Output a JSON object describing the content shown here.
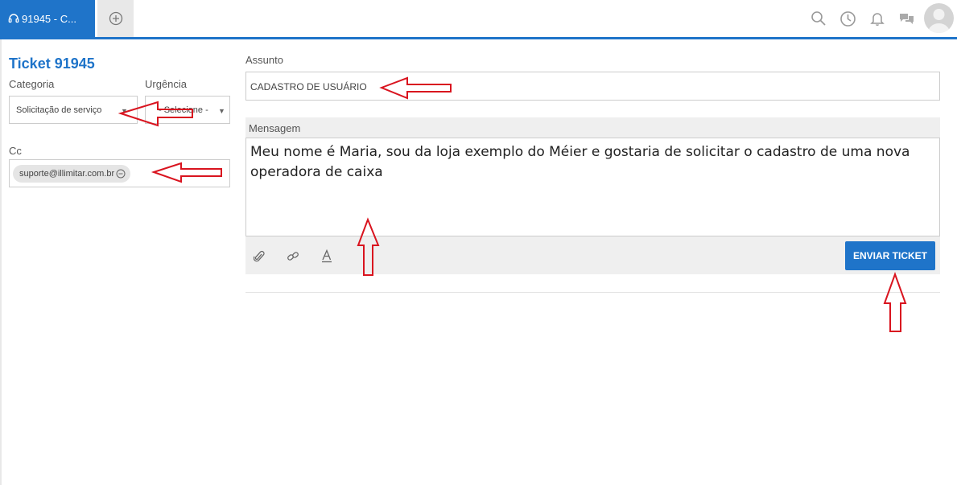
{
  "tabs": [
    {
      "label": "91945 - C..."
    }
  ],
  "header_icons": [
    "search-icon",
    "history-icon",
    "bell-icon",
    "chat-icon"
  ],
  "colors": {
    "accent": "#1f74c9",
    "annotation_arrow": "#d9141f"
  },
  "ticket": {
    "title": "Ticket 91945",
    "categoria_label": "Categoria",
    "categoria_value": "Solicitação de serviço",
    "urgencia_label": "Urgência",
    "urgencia_value": "- Selecione -",
    "cc_label": "Cc",
    "cc_value": "suporte@illimitar.com.br"
  },
  "subject": {
    "label": "Assunto",
    "value": "CADASTRO DE USUÁRIO"
  },
  "message": {
    "label": "Mensagem",
    "body": "Meu nome é Maria, sou da loja exemplo do Méier e gostaria de solicitar o cadastro de uma nova operadora de caixa"
  },
  "toolbar_icons": [
    "paperclip-icon",
    "link-icon",
    "text-format-icon"
  ],
  "send_button": "ENVIAR TICKET"
}
